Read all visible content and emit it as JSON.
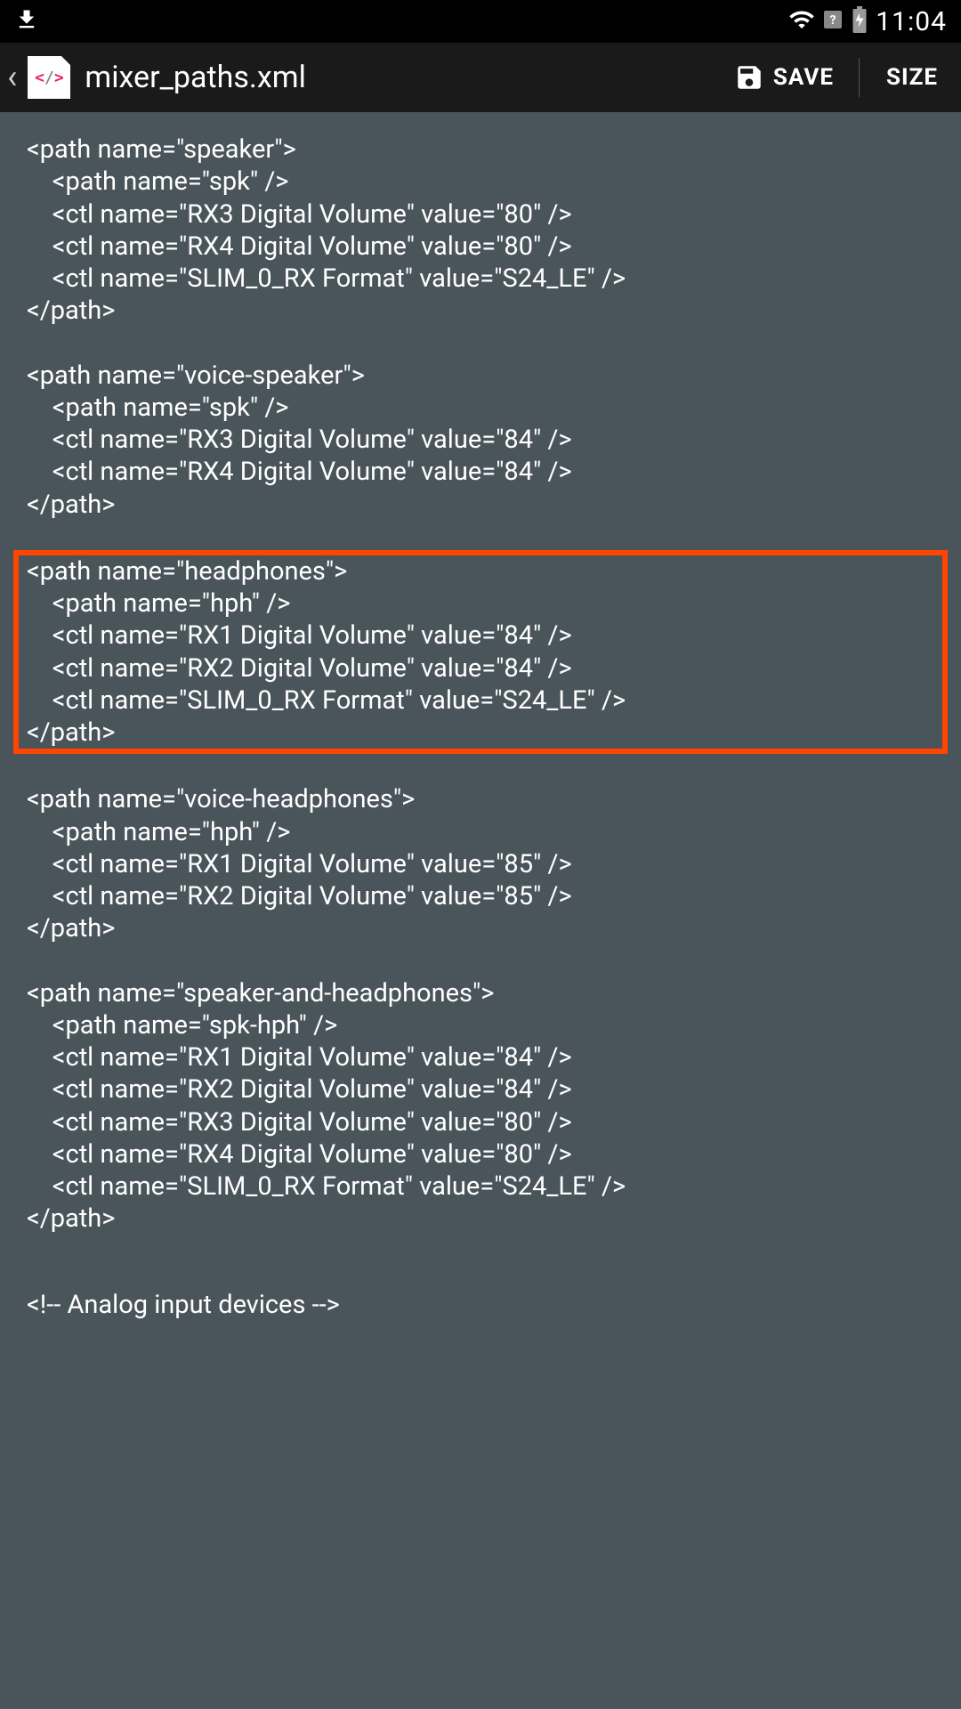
{
  "status": {
    "time": "11:04"
  },
  "appbar": {
    "title": "mixer_paths.xml",
    "save_label": "SAVE",
    "size_label": "SIZE"
  },
  "code": {
    "blocks": [
      {
        "highlighted": false,
        "lines": [
          "<path name=\"speaker\">",
          "    <path name=\"spk\" />",
          "    <ctl name=\"RX3 Digital Volume\" value=\"80\" />",
          "    <ctl name=\"RX4 Digital Volume\" value=\"80\" />",
          "    <ctl name=\"SLIM_0_RX Format\" value=\"S24_LE\" />",
          "</path>"
        ]
      },
      {
        "highlighted": false,
        "lines": [
          "<path name=\"voice-speaker\">",
          "    <path name=\"spk\" />",
          "    <ctl name=\"RX3 Digital Volume\" value=\"84\" />",
          "    <ctl name=\"RX4 Digital Volume\" value=\"84\" />",
          "</path>"
        ]
      },
      {
        "highlighted": true,
        "lines": [
          "<path name=\"headphones\">",
          "    <path name=\"hph\" />",
          "    <ctl name=\"RX1 Digital Volume\" value=\"84\" />",
          "    <ctl name=\"RX2 Digital Volume\" value=\"84\" />",
          "    <ctl name=\"SLIM_0_RX Format\" value=\"S24_LE\" />",
          "</path>"
        ]
      },
      {
        "highlighted": false,
        "lines": [
          "<path name=\"voice-headphones\">",
          "    <path name=\"hph\" />",
          "    <ctl name=\"RX1 Digital Volume\" value=\"85\" />",
          "    <ctl name=\"RX2 Digital Volume\" value=\"85\" />",
          "</path>"
        ]
      },
      {
        "highlighted": false,
        "lines": [
          "<path name=\"speaker-and-headphones\">",
          "    <path name=\"spk-hph\" />",
          "    <ctl name=\"RX1 Digital Volume\" value=\"84\" />",
          "    <ctl name=\"RX2 Digital Volume\" value=\"84\" />",
          "    <ctl name=\"RX3 Digital Volume\" value=\"80\" />",
          "    <ctl name=\"RX4 Digital Volume\" value=\"80\" />",
          "    <ctl name=\"SLIM_0_RX Format\" value=\"S24_LE\" />",
          "</path>"
        ]
      }
    ],
    "trailing_comment": "<!-- Analog input devices -->"
  }
}
